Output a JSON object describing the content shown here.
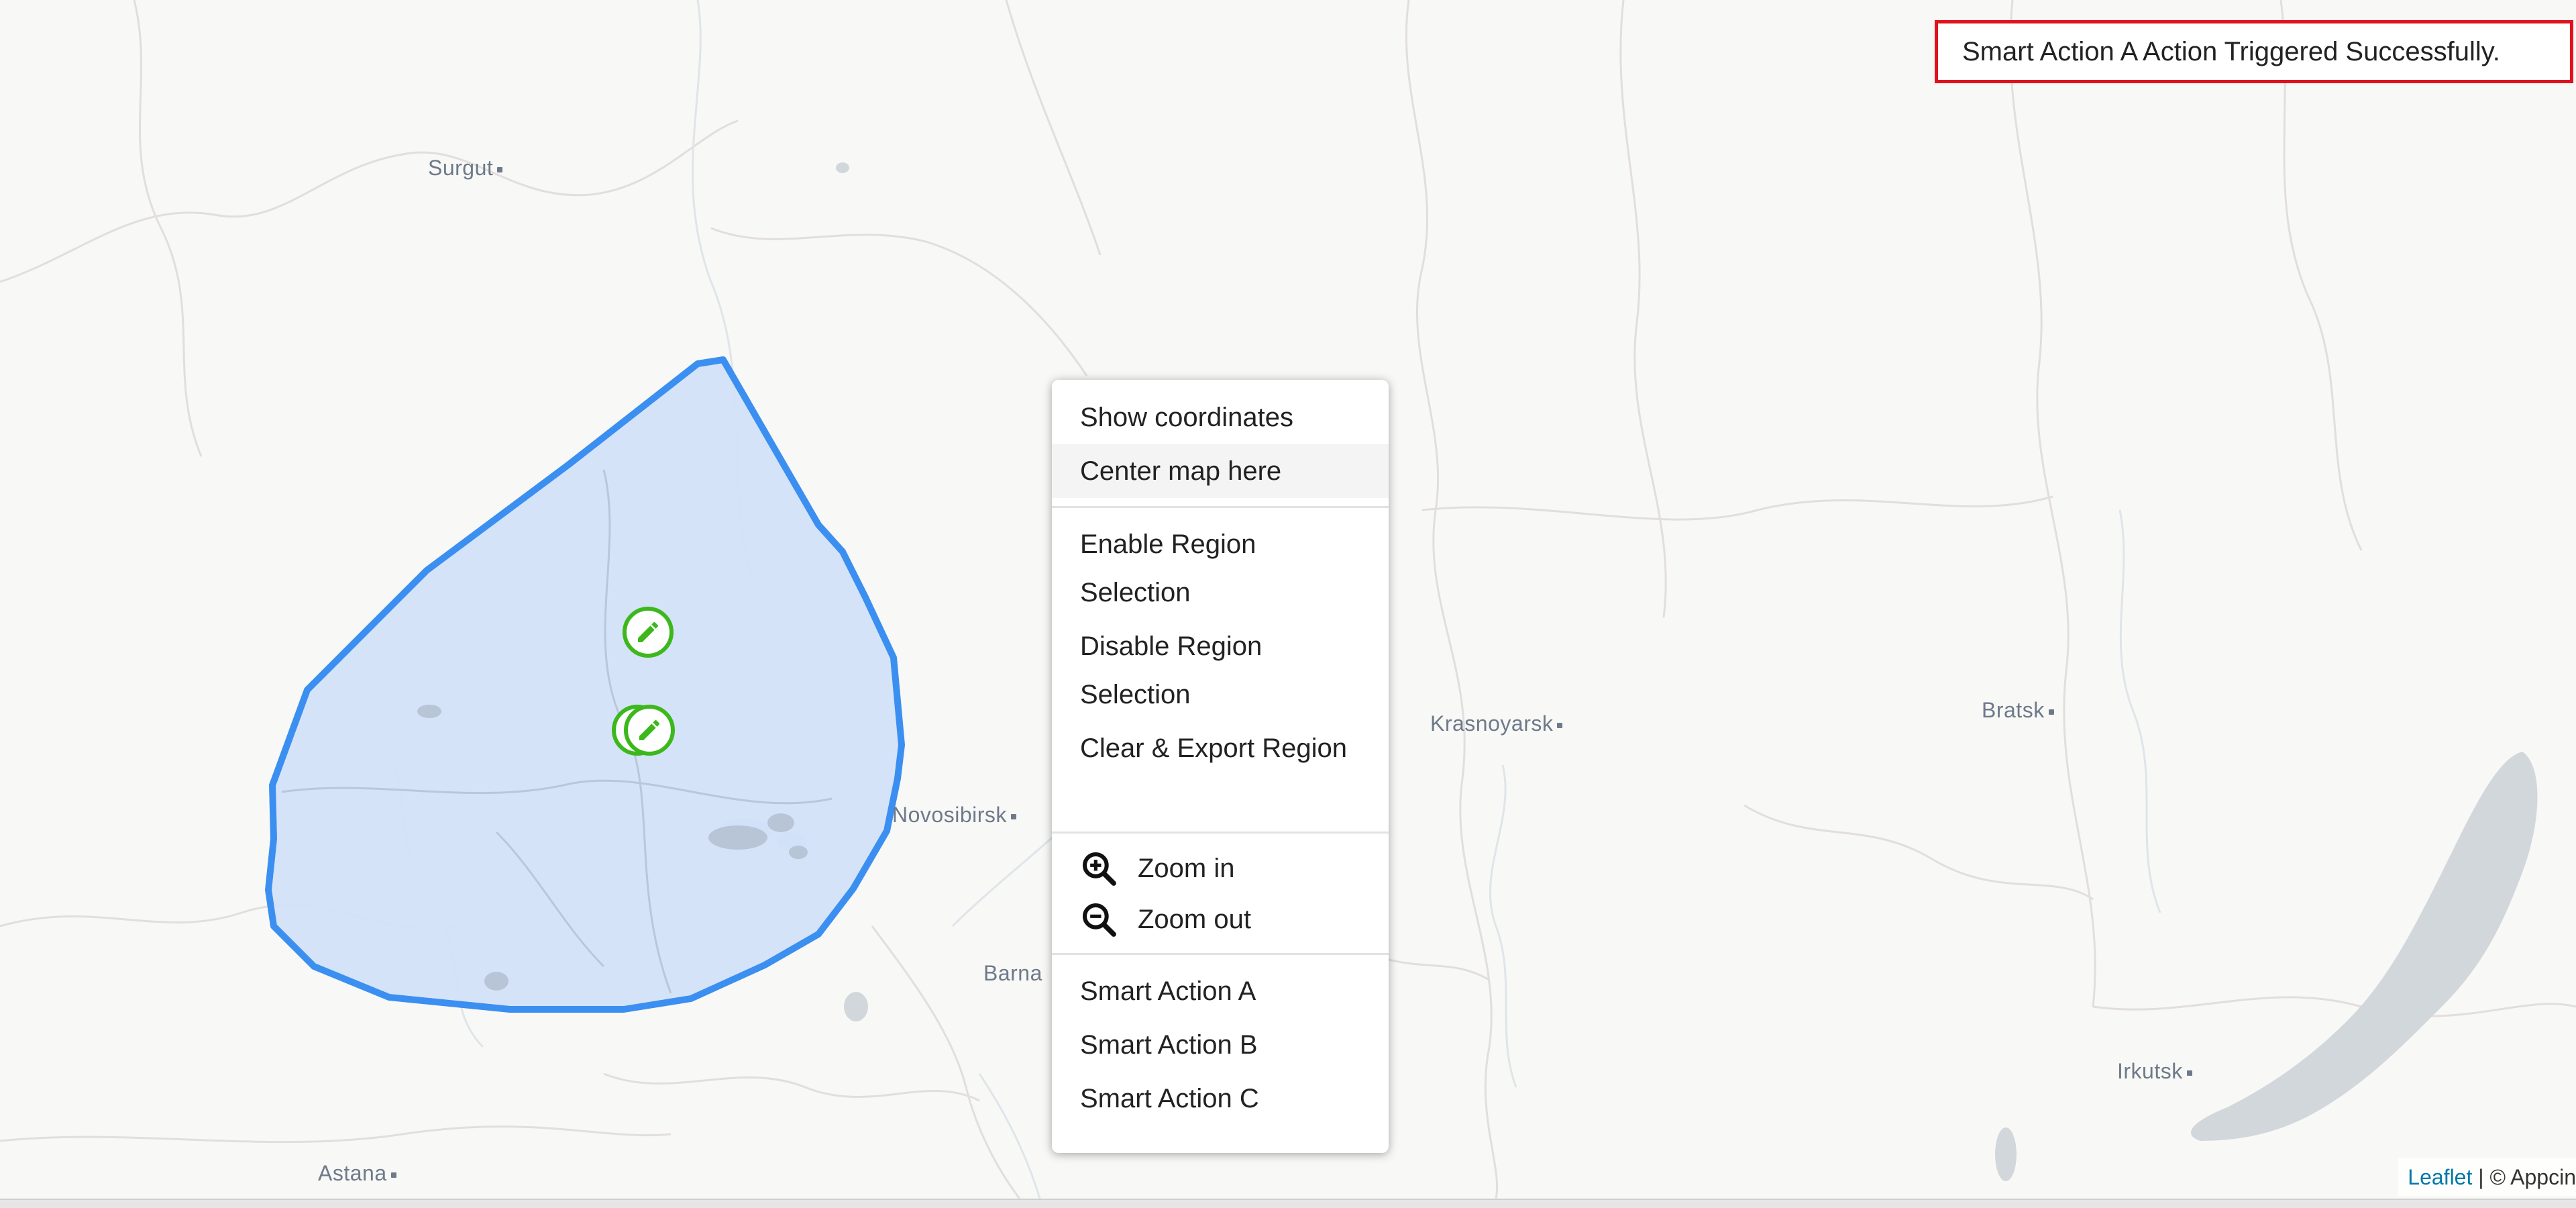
{
  "notification": {
    "text": "Smart Action A Action Triggered Successfully."
  },
  "cities": [
    {
      "name": "Surgut"
    },
    {
      "name": "Novosibirsk"
    },
    {
      "name": "Barna"
    },
    {
      "name": "Astana"
    },
    {
      "name": "Krasnoyarsk"
    },
    {
      "name": "Bratsk"
    },
    {
      "name": "Irkutsk"
    }
  ],
  "context_menu": {
    "show_coordinates": "Show coordinates",
    "center_map": "Center map here",
    "enable_region": "Enable Region Selection",
    "disable_region": "Disable Region Selection",
    "clear_export": "Clear & Export Region",
    "zoom_in": "Zoom in",
    "zoom_out": "Zoom out",
    "smart_a": "Smart Action A",
    "smart_b": "Smart Action B",
    "smart_c": "Smart Action C"
  },
  "attribution": {
    "leaflet": "Leaflet",
    "rest": " | © Appcin"
  },
  "icons": {
    "marker": "pencil-icon",
    "zoom_in": "zoom-in-icon",
    "zoom_out": "zoom-out-icon"
  },
  "colors": {
    "region_stroke": "#3b8ff0",
    "region_fill": "#d2e2f8",
    "marker": "#3cb81c",
    "notification_border": "#e0121c",
    "water": "#d2d7db"
  }
}
